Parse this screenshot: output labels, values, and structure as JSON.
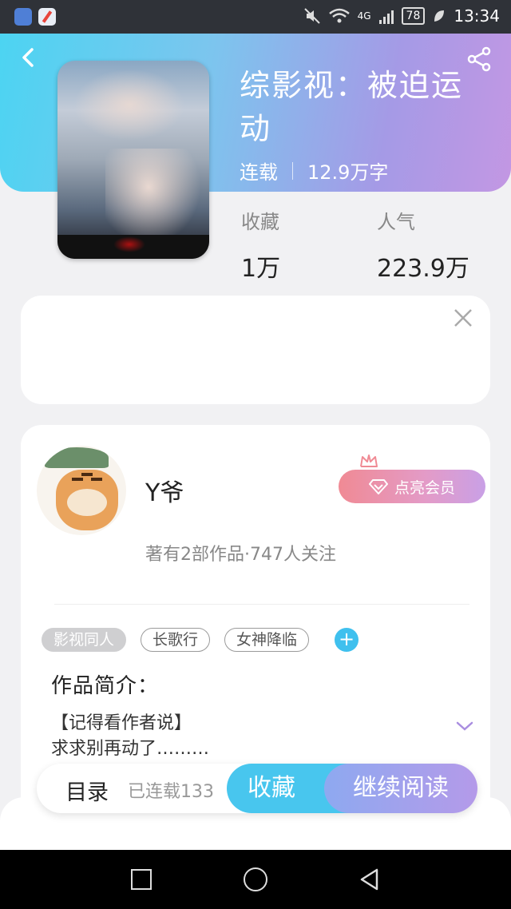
{
  "status_bar": {
    "network": "4G",
    "battery": "78",
    "time": "13:34"
  },
  "book": {
    "title": "综影视：被迫运动",
    "status": "连载",
    "word_count": "12.9万字",
    "stats": [
      {
        "label": "收藏",
        "value": "1万"
      },
      {
        "label": "人气",
        "value": "223.9万"
      }
    ]
  },
  "author": {
    "name": "Y爷",
    "stats": "著有2部作品·747人关注",
    "vip_button": "点亮会员"
  },
  "tags": [
    "影视同人",
    "长歌行",
    "女神降临"
  ],
  "intro": {
    "title": "作品简介：",
    "text": "【记得看作者说】\n求求别再动了………"
  },
  "action_bar": {
    "toc_label": "目录",
    "toc_count": "已连载133",
    "favorite": "收藏",
    "continue_read": "继续阅读"
  },
  "colors": {
    "accent_blue": "#48c6ee",
    "accent_purple": "#b49ae9",
    "vip_pink": "#f08a94"
  },
  "icons": [
    "back-icon",
    "share-icon",
    "close-icon",
    "crown-icon",
    "diamond-icon",
    "add-icon",
    "chevron-down-icon"
  ]
}
